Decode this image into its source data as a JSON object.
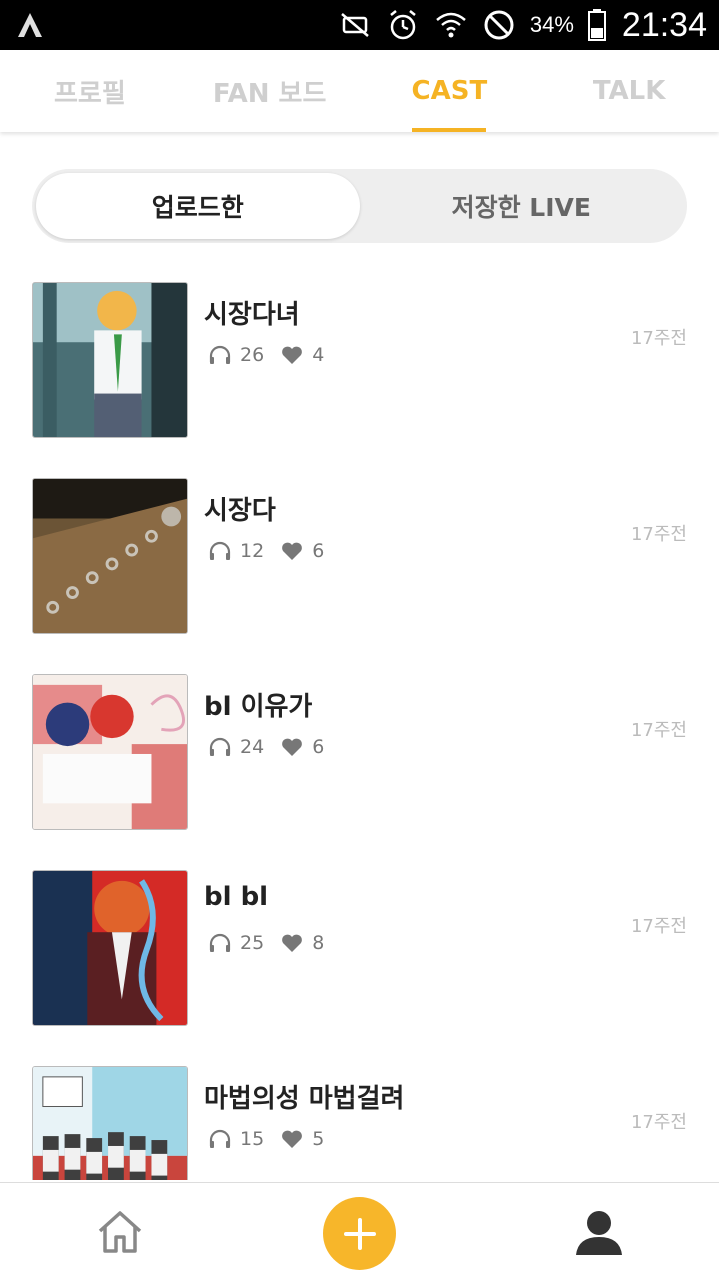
{
  "status_bar": {
    "battery": "34%",
    "time": "21:34",
    "icons": [
      "app-logo-icon",
      "mute-icon",
      "alarm-icon",
      "wifi-icon",
      "no-disturb-icon",
      "battery-icon"
    ]
  },
  "top_tabs": [
    {
      "label": "프로필",
      "active": false
    },
    {
      "label": "FAN 보드",
      "active": false
    },
    {
      "label": "CAST",
      "active": true
    },
    {
      "label": "TALK",
      "active": false
    }
  ],
  "segment": {
    "uploaded": "업로드한",
    "saved_live": "저장한 LIVE",
    "active": "uploaded"
  },
  "cast_items": [
    {
      "title": "시장다녀",
      "plays": "26",
      "likes": "4",
      "time": "17주전"
    },
    {
      "title": "시장다",
      "plays": "12",
      "likes": "6",
      "time": "17주전"
    },
    {
      "title": "bl 이유가",
      "plays": "24",
      "likes": "6",
      "time": "17주전"
    },
    {
      "title": "bl bl",
      "plays": "25",
      "likes": "8",
      "time": "17주전"
    },
    {
      "title": "마법의성 마법걸려",
      "plays": "15",
      "likes": "5",
      "time": "17주전"
    }
  ],
  "colors": {
    "accent": "#f5b324",
    "inactive_tab": "#cfcfcf",
    "time_text": "#bbbbbb"
  },
  "bottom_nav": [
    "home-icon",
    "add-icon",
    "profile-icon"
  ]
}
